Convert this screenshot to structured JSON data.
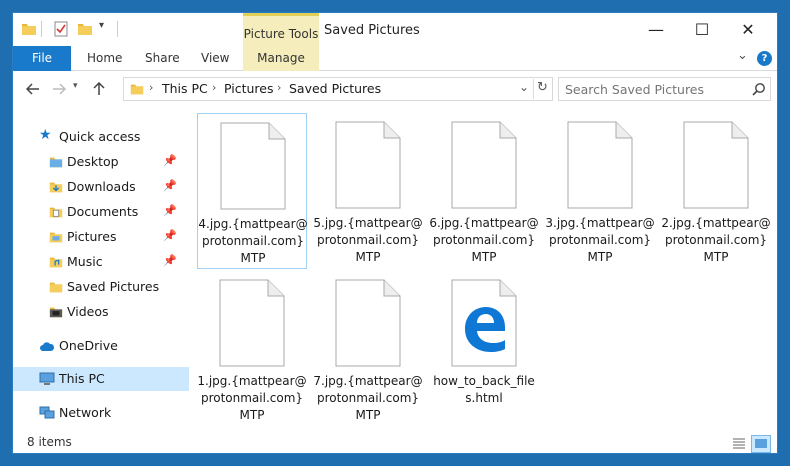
{
  "titlebar": {
    "context_tab": "Picture Tools",
    "title": "Saved Pictures",
    "minimize": "—",
    "maximize": "☐",
    "close": "✕"
  },
  "ribbon": {
    "file": "File",
    "tabs": [
      "Home",
      "Share",
      "View"
    ],
    "manage": "Manage",
    "expand": "⌄",
    "help": "?"
  },
  "address": {
    "crumbs": [
      "This PC",
      "Pictures",
      "Saved Pictures"
    ],
    "dropdown": "⌄",
    "refresh": "↻"
  },
  "search": {
    "placeholder": "Search Saved Pictures",
    "icon": "search-icon"
  },
  "nav": {
    "quick_access": "Quick access",
    "items": [
      {
        "label": "Desktop",
        "icon": "desktop-folder-icon",
        "pinned": true
      },
      {
        "label": "Downloads",
        "icon": "downloads-folder-icon",
        "pinned": true
      },
      {
        "label": "Documents",
        "icon": "documents-folder-icon",
        "pinned": true
      },
      {
        "label": "Pictures",
        "icon": "pictures-folder-icon",
        "pinned": true
      },
      {
        "label": "Music",
        "icon": "music-folder-icon",
        "pinned": true
      },
      {
        "label": "Saved Pictures",
        "icon": "folder-icon",
        "pinned": false
      },
      {
        "label": "Videos",
        "icon": "videos-folder-icon",
        "pinned": false
      }
    ],
    "onedrive": "OneDrive",
    "thispc": "This PC",
    "network": "Network"
  },
  "files": [
    {
      "name": "4.jpg.{mattpear@protonmail.com}MTP",
      "line1": "4.jpg.{mattpear@",
      "line2": "protonmail.com}",
      "line3": "MTP",
      "type": "document",
      "selected": true
    },
    {
      "name": "5.jpg.{mattpear@protonmail.com}MTP",
      "line1": "5.jpg.{mattpear@",
      "line2": "protonmail.com}",
      "line3": "MTP",
      "type": "document",
      "selected": false
    },
    {
      "name": "6.jpg.{mattpear@protonmail.com}MTP",
      "line1": "6.jpg.{mattpear@",
      "line2": "protonmail.com}",
      "line3": "MTP",
      "type": "document",
      "selected": false
    },
    {
      "name": "3.jpg.{mattpear@protonmail.com}MTP",
      "line1": "3.jpg.{mattpear@",
      "line2": "protonmail.com}",
      "line3": "MTP",
      "type": "document",
      "selected": false
    },
    {
      "name": "2.jpg.{mattpear@protonmail.com}MTP",
      "line1": "2.jpg.{mattpear@",
      "line2": "protonmail.com}",
      "line3": "MTP",
      "type": "document",
      "selected": false
    },
    {
      "name": "1.jpg.{mattpear@protonmail.com}MTP",
      "line1": "1.jpg.{mattpear@",
      "line2": "protonmail.com}",
      "line3": "MTP",
      "type": "document",
      "selected": false
    },
    {
      "name": "7.jpg.{mattpear@protonmail.com}MTP",
      "line1": "7.jpg.{mattpear@",
      "line2": "protonmail.com}",
      "line3": "MTP",
      "type": "document",
      "selected": false
    },
    {
      "name": "how_to_back_files.html",
      "line1": "how_to_back_file",
      "line2": "s.html",
      "line3": "",
      "type": "edge-html",
      "selected": false
    }
  ],
  "status": {
    "count": "8 items"
  },
  "colors": {
    "accent": "#1979ca",
    "selection": "#cce8ff",
    "context_tab": "#f5eebc",
    "edge_blue": "#0f78d4"
  }
}
